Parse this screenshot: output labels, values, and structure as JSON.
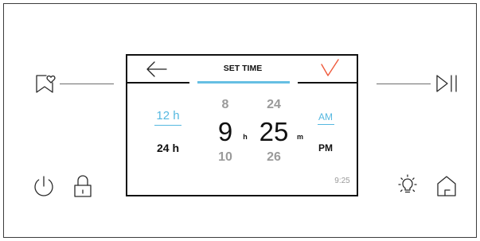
{
  "panel": {
    "icons": {
      "favorite": "bookmark-heart-icon",
      "play_pause": "play-pause-icon",
      "power": "power-icon",
      "lock": "lock-icon",
      "light": "light-bulb-icon",
      "home": "home-icon"
    }
  },
  "screen": {
    "title": "SET TIME",
    "icons": {
      "back": "arrow-left-icon",
      "confirm": "checkmark-icon"
    },
    "time_format": [
      {
        "label": "12 h",
        "selected": true
      },
      {
        "label": "24 h",
        "selected": false
      }
    ],
    "hours": {
      "prev": "8",
      "current": "9",
      "next": "10",
      "unit": "h"
    },
    "minutes": {
      "prev": "24",
      "current": "25",
      "next": "26",
      "unit": "m"
    },
    "period": [
      {
        "label": "AM",
        "selected": true
      },
      {
        "label": "PM",
        "selected": false
      }
    ],
    "clock": "9:25"
  },
  "colors": {
    "accent": "#55b8e0",
    "confirm": "#ef5a3c",
    "text": "#111111",
    "muted": "#9a9a9a"
  }
}
